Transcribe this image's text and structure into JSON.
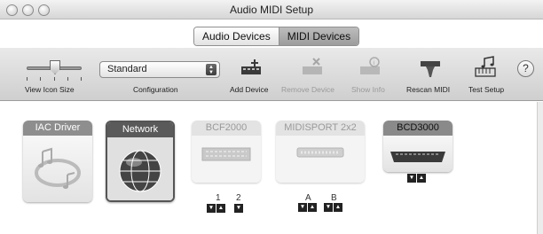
{
  "window": {
    "title": "Audio MIDI Setup"
  },
  "tabs": [
    {
      "label": "Audio Devices",
      "active": false
    },
    {
      "label": "MIDI Devices",
      "active": true
    }
  ],
  "toolbar": {
    "view_icon_size_label": "View Icon Size",
    "configuration": {
      "value": "Standard",
      "label": "Configuration"
    },
    "add_device_label": "Add Device",
    "remove_device_label": "Remove Device",
    "show_info_label": "Show Info",
    "rescan_midi_label": "Rescan MIDI",
    "test_setup_label": "Test Setup",
    "help_label": "?"
  },
  "devices": [
    {
      "name": "IAC Driver",
      "header_color": "#8e8e8e",
      "selected": false,
      "enabled": true
    },
    {
      "name": "Network",
      "header_color": "#5a5a5a",
      "selected": true,
      "enabled": true
    },
    {
      "name": "BCF2000",
      "header_color": "#e3e3e3",
      "enabled": false,
      "ports": [
        "1",
        "2"
      ]
    },
    {
      "name": "MIDISPORT 2x2",
      "header_color": "#e3e3e3",
      "enabled": false,
      "ports": [
        "A",
        "B"
      ]
    },
    {
      "name": "BCD3000",
      "header_color": "#8a8a8a",
      "enabled": true
    }
  ],
  "colors": {
    "toolbar_bg": "#d9d9d9",
    "active_tab": "#a8a8a8"
  }
}
